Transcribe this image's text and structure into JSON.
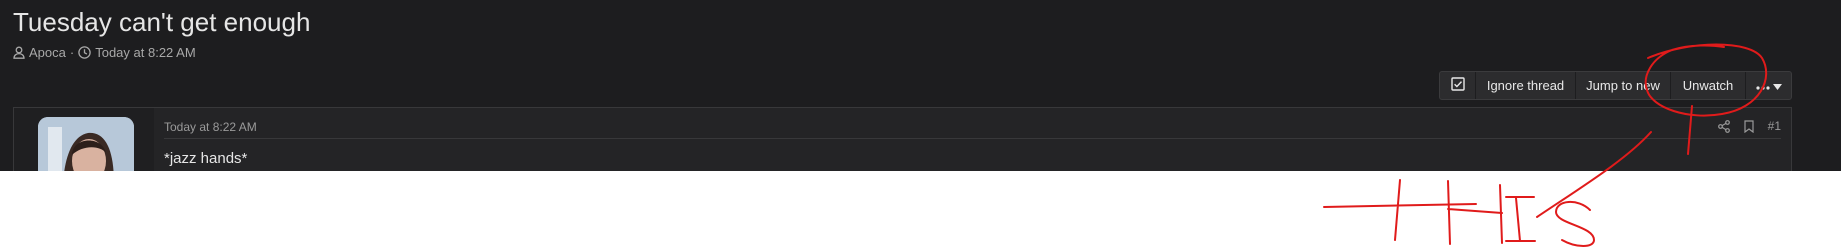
{
  "thread": {
    "title": "Tuesday can't get enough",
    "author": "Apoca",
    "separator": "·",
    "timestamp": "Today at 8:22 AM"
  },
  "toolbar": {
    "ignore_label": "Ignore thread",
    "jump_label": "Jump to new",
    "unwatch_label": "Unwatch"
  },
  "post": {
    "date": "Today at 8:22 AM",
    "number": "#1",
    "body": "*jazz hands*"
  },
  "annotation": {
    "text": "THIS",
    "color": "#e01b1b"
  },
  "colors": {
    "background": "#1d1d1f",
    "text": "#e6e6e6",
    "muted": "#a8a8a8",
    "button": "#2c2c2e",
    "annotation": "#e01b1b"
  },
  "icons": [
    "user-icon",
    "clock-icon",
    "checkbox-icon",
    "ellipsis-icon",
    "caret-down-icon",
    "share-icon",
    "bookmark-icon"
  ]
}
